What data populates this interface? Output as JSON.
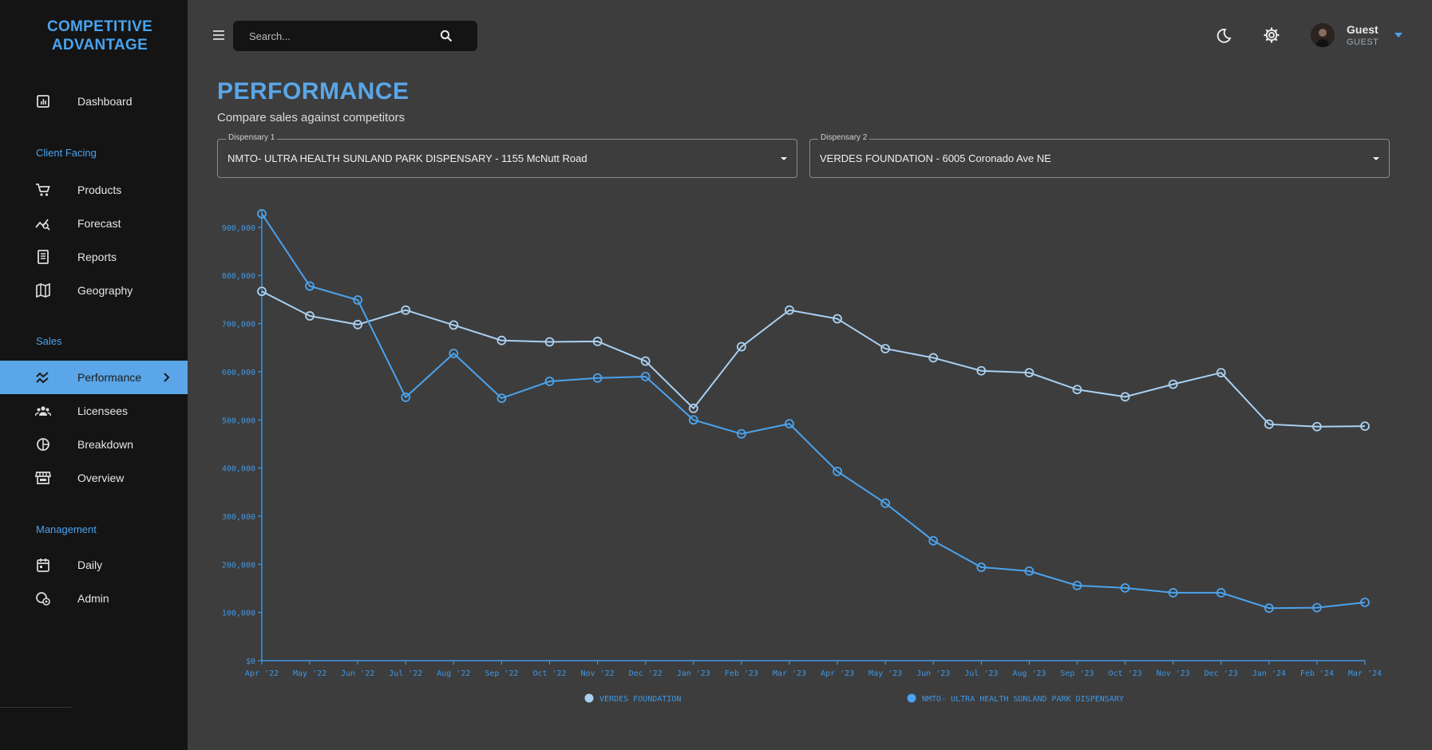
{
  "app": {
    "brand_line1": "COMPETITIVE",
    "brand_line2": "ADVANTAGE"
  },
  "sidebar": {
    "items": [
      {
        "label": "Dashboard",
        "icon": "dashboard-icon"
      },
      {
        "section": "Client Facing"
      },
      {
        "label": "Products",
        "icon": "cart-icon"
      },
      {
        "label": "Forecast",
        "icon": "forecast-icon"
      },
      {
        "label": "Reports",
        "icon": "reports-icon"
      },
      {
        "label": "Geography",
        "icon": "map-icon"
      },
      {
        "section": "Sales"
      },
      {
        "label": "Performance",
        "icon": "performance-icon",
        "active": true
      },
      {
        "label": "Licensees",
        "icon": "people-icon"
      },
      {
        "label": "Breakdown",
        "icon": "pie-icon"
      },
      {
        "label": "Overview",
        "icon": "store-icon"
      },
      {
        "section": "Management"
      },
      {
        "label": "Daily",
        "icon": "calendar-icon"
      },
      {
        "label": "Admin",
        "icon": "admin-icon"
      }
    ]
  },
  "search": {
    "placeholder": "Search..."
  },
  "user": {
    "name": "Guest",
    "role": "GUEST"
  },
  "page": {
    "title": "PERFORMANCE",
    "subtitle": "Compare sales against competitors"
  },
  "selects": {
    "d1_label": "Dispensary 1",
    "d1_value": "NMTO- ULTRA HEALTH SUNLAND PARK DISPENSARY - 1155 McNutt Road",
    "d2_label": "Dispensary 2",
    "d2_value": "VERDES FOUNDATION - 6005 Coronado Ave NE"
  },
  "colors": {
    "accent": "#4aa3ee",
    "verdes": "#a9d0f2",
    "nmto": "#4aa3ee",
    "bg": "#3d3d3d",
    "sidebar": "#141414"
  },
  "chart_data": {
    "type": "line",
    "categories": [
      "Apr '22",
      "May '22",
      "Jun '22",
      "Jul '22",
      "Aug '22",
      "Sep '22",
      "Oct '22",
      "Nov '22",
      "Dec '22",
      "Jan '23",
      "Feb '23",
      "Mar '23",
      "Apr '23",
      "May '23",
      "Jun '23",
      "Jul '23",
      "Aug '23",
      "Sep '23",
      "Oct '23",
      "Nov '23",
      "Dec '23",
      "Jan '24",
      "Feb '24",
      "Mar '24"
    ],
    "yticks": [
      "$0",
      "100,000",
      "200,000",
      "300,000",
      "400,000",
      "500,000",
      "600,000",
      "700,000",
      "800,000",
      "900,000"
    ],
    "ylim": [
      0,
      928000
    ],
    "legend_position": "bottom",
    "series": [
      {
        "name": "VERDES FOUNDATION",
        "color": "#a9d0f2",
        "values": [
          767000,
          716000,
          698000,
          728000,
          697000,
          665000,
          662000,
          663000,
          622000,
          524000,
          652000,
          728000,
          710000,
          648000,
          629000,
          602000,
          598000,
          563000,
          548000,
          574000,
          598000,
          491000,
          486000,
          487000
        ]
      },
      {
        "name": "NMTO- ULTRA HEALTH SUNLAND PARK DISPENSARY",
        "color": "#4aa3ee",
        "values": [
          928000,
          778000,
          749000,
          547000,
          638000,
          545000,
          580000,
          587000,
          590000,
          500000,
          471000,
          492000,
          393000,
          327000,
          249000,
          194000,
          186000,
          156000,
          151000,
          141000,
          141000,
          109000,
          110000,
          121000
        ]
      }
    ]
  }
}
